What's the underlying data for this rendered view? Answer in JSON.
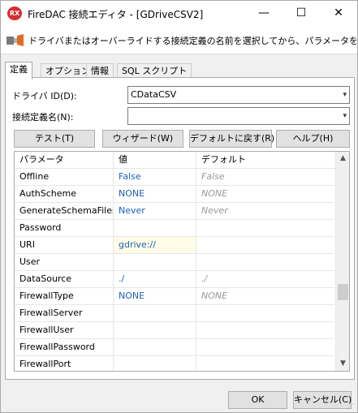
{
  "window": {
    "title": "FireDAC 接続エディタ - [GDriveCSV2]",
    "app_icon_text": "RX",
    "minimize": "—",
    "maximize": "☐",
    "close": "✕"
  },
  "banner": {
    "text": "ドライバまたはオーバーライドする接続定義の名前を選択してから、パラメータをセットアップ"
  },
  "tabs": [
    "定義",
    "オプション",
    "情報",
    "SQL スクリプト"
  ],
  "form": {
    "driver_id_label": "ドライバ ID(D):",
    "driver_id_value": "CDataCSV",
    "conn_def_label": "接続定義名(N):",
    "conn_def_value": ""
  },
  "buttons": {
    "test": "テスト(T)",
    "wizard": "ウィザード(W)",
    "revert": "デフォルトに戻す(R)",
    "help": "ヘルプ(H)"
  },
  "grid": {
    "headers": [
      "パラメータ",
      "値",
      "デフォルト"
    ],
    "rows": [
      {
        "param": "Offline",
        "value": "False",
        "default": "False"
      },
      {
        "param": "AuthScheme",
        "value": "NONE",
        "default": "NONE"
      },
      {
        "param": "GenerateSchemaFiles",
        "value": "Never",
        "default": "Never"
      },
      {
        "param": "Password",
        "value": "",
        "default": ""
      },
      {
        "param": "URI",
        "value": "gdrive://",
        "default": ""
      },
      {
        "param": "User",
        "value": "",
        "default": ""
      },
      {
        "param": "DataSource",
        "value": "./",
        "default": "./"
      },
      {
        "param": "FirewallType",
        "value": "NONE",
        "default": "NONE"
      },
      {
        "param": "FirewallServer",
        "value": "",
        "default": ""
      },
      {
        "param": "FirewallUser",
        "value": "",
        "default": ""
      },
      {
        "param": "FirewallPassword",
        "value": "",
        "default": ""
      },
      {
        "param": "FirewallPort",
        "value": "",
        "default": ""
      }
    ]
  },
  "footer": {
    "ok": "OK",
    "cancel": "キャンセル(C)"
  }
}
